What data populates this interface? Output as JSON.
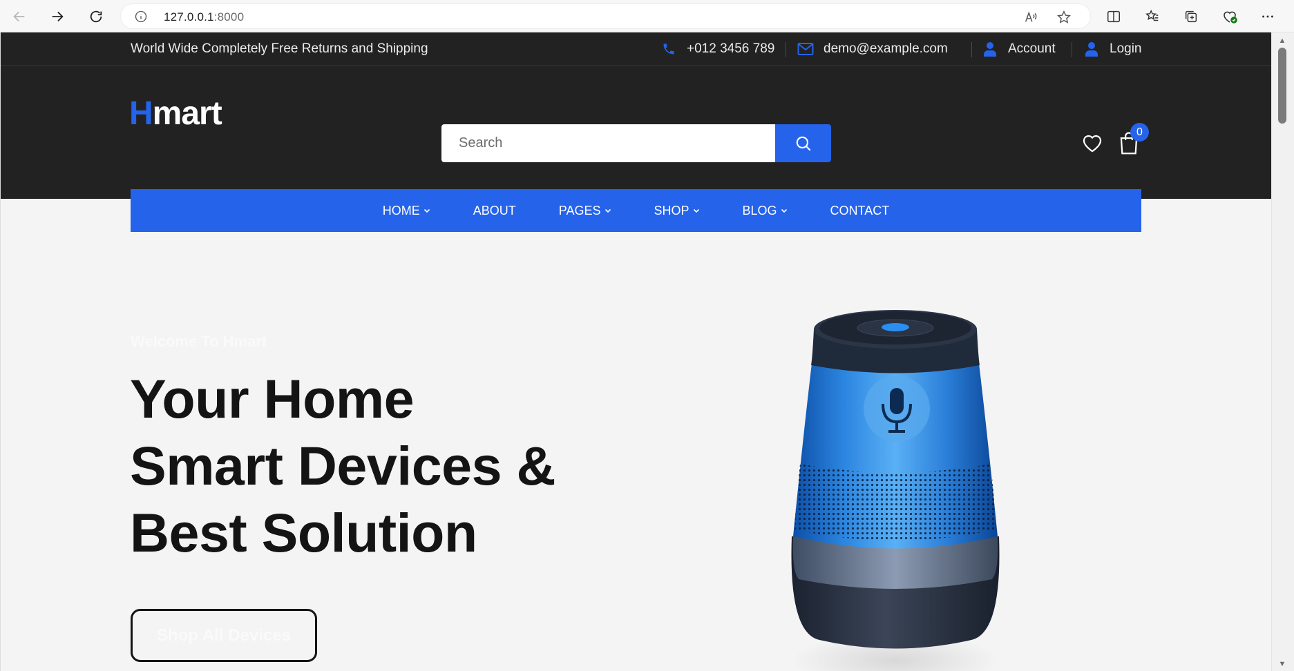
{
  "browser": {
    "url_host": "127.0.0.1",
    "url_port": ":8000"
  },
  "topbar": {
    "announcement": "World Wide Completely Free Returns and Shipping",
    "phone": "+012 3456 789",
    "email": "demo@example.com",
    "account_label": "Account",
    "login_label": "Login"
  },
  "header": {
    "logo_first": "H",
    "logo_rest": "mart",
    "search_placeholder": "Search",
    "cart_count": "0"
  },
  "menu": {
    "items": [
      {
        "label": "HOME",
        "has_dropdown": true
      },
      {
        "label": "ABOUT",
        "has_dropdown": false
      },
      {
        "label": "PAGES",
        "has_dropdown": true
      },
      {
        "label": "SHOP",
        "has_dropdown": true
      },
      {
        "label": "BLOG",
        "has_dropdown": true
      },
      {
        "label": "CONTACT",
        "has_dropdown": false
      }
    ]
  },
  "hero": {
    "subtitle": "Welcome To Hmart",
    "title_lines": [
      "Your Home",
      "Smart Devices &",
      "Best Solution"
    ],
    "button_label": "Shop All Devices"
  },
  "colors": {
    "accent": "#2563eb",
    "dark": "#222222",
    "hero_bg": "#f4f4f4"
  }
}
